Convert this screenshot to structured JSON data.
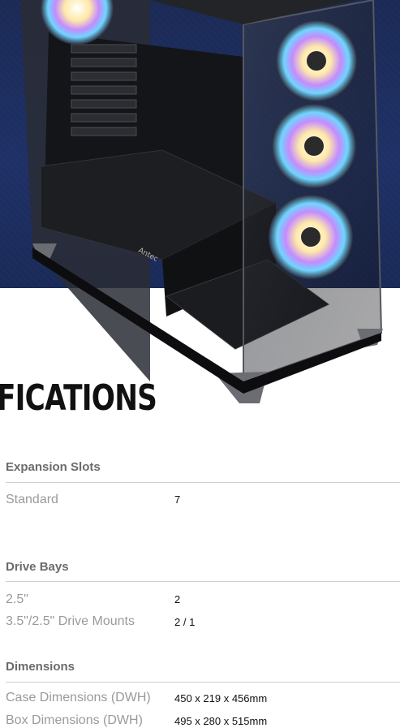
{
  "page": {
    "title": "FICATIONS",
    "brand_mark": "Antec"
  },
  "specs": {
    "expansion": {
      "heading": "Expansion Slots",
      "rows": [
        {
          "label": "Standard",
          "value": "7"
        }
      ]
    },
    "drive_bays": {
      "heading": "Drive Bays",
      "rows": [
        {
          "label": "2.5\"",
          "value": "2"
        },
        {
          "label": "3.5\"/2.5\" Drive Mounts",
          "value": "2 / 1"
        }
      ]
    },
    "dimensions": {
      "heading": "Dimensions",
      "rows": [
        {
          "label": "Case Dimensions (DWH)",
          "value": "450 x 219 x 456mm"
        },
        {
          "label": "Box Dimensions (DWH)",
          "value": "495 x 280 x 515mm"
        }
      ]
    }
  },
  "colors": {
    "hero_bg": "#1e3066",
    "case": "#1a1a1a",
    "heading": "#6b6b6b",
    "label": "#9a9a9a"
  }
}
